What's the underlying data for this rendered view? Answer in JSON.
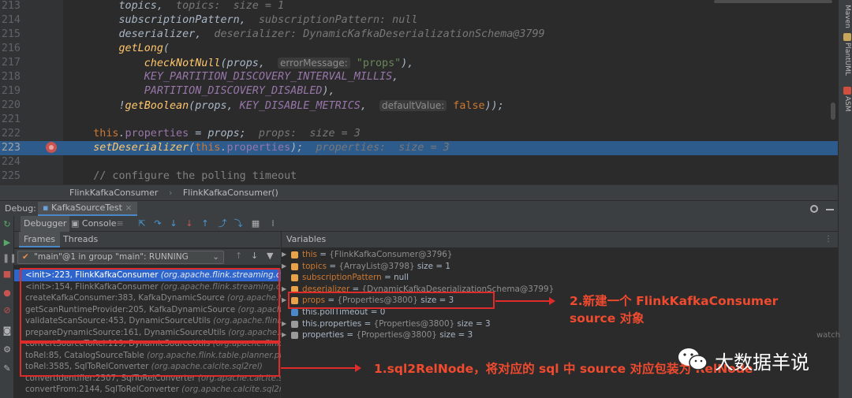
{
  "editor": {
    "lines": [
      {
        "num": "213",
        "code": [
          [
            "fnplain",
            "topics,"
          ],
          [
            "hint",
            "  topics:  size = 1"
          ]
        ],
        "indent": 8
      },
      {
        "num": "214",
        "code": [
          [
            "fnplain",
            "subscriptionPattern,"
          ],
          [
            "hint",
            "  subscriptionPattern: null"
          ]
        ],
        "indent": 8
      },
      {
        "num": "215",
        "code": [
          [
            "fnplain",
            "deserializer,"
          ],
          [
            "hint",
            "  deserializer: DynamicKafkaDeserializationSchema@3799"
          ]
        ],
        "indent": 8
      },
      {
        "num": "216",
        "code": [
          [
            "fn",
            "getLong"
          ],
          [
            "fnplain",
            "("
          ]
        ],
        "indent": 8
      },
      {
        "num": "217",
        "code": [
          [
            "fn",
            "checkNotNull"
          ],
          [
            "fnplain",
            "(props,  "
          ],
          [
            "pill",
            "errorMessage:"
          ],
          [
            "str",
            " \"props\""
          ],
          [
            "fnplain",
            "),"
          ]
        ],
        "indent": 12
      },
      {
        "num": "218",
        "code": [
          [
            "cst",
            "KEY_PARTITION_DISCOVERY_INTERVAL_MILLIS"
          ],
          [
            "fnplain",
            ","
          ]
        ],
        "indent": 12
      },
      {
        "num": "219",
        "code": [
          [
            "cst",
            "PARTITION_DISCOVERY_DISABLED"
          ],
          [
            "fnplain",
            "),"
          ]
        ],
        "indent": 12
      },
      {
        "num": "220",
        "code": [
          [
            "fnplain",
            "!"
          ],
          [
            "fn",
            "getBoolean"
          ],
          [
            "fnplain",
            "(props, "
          ],
          [
            "cst",
            "KEY_DISABLE_METRICS"
          ],
          [
            "fnplain",
            ",  "
          ],
          [
            "pill",
            "defaultValue:"
          ],
          [
            "kw",
            " false"
          ],
          [
            "fnplain",
            "));"
          ]
        ],
        "indent": 8
      },
      {
        "num": "221",
        "code": [],
        "indent": 0
      },
      {
        "num": "222",
        "code": [
          [
            "kw",
            "this"
          ],
          [
            "fnplain",
            "."
          ],
          [
            "prop",
            "properties"
          ],
          [
            "fnplain",
            " = props;"
          ],
          [
            "hint",
            "  props:  size = 3"
          ]
        ],
        "indent": 4
      },
      {
        "num": "223",
        "code": [
          [
            "fn",
            "setDeserializer"
          ],
          [
            "fnplain",
            "("
          ],
          [
            "kw",
            "this"
          ],
          [
            "fnplain",
            "."
          ],
          [
            "prop",
            "properties"
          ],
          [
            "fnplain",
            ");"
          ],
          [
            "hint",
            "  properties:  size = 3"
          ]
        ],
        "indent": 4,
        "highlight": true
      },
      {
        "num": "224",
        "code": [],
        "indent": 0
      },
      {
        "num": "225",
        "code": [
          [
            "cmt",
            "// configure the polling timeout"
          ]
        ],
        "indent": 4
      }
    ]
  },
  "breadcrumb": {
    "class_name": "FlinkKafkaConsumer",
    "method_name": "FlinkKafkaConsumer()"
  },
  "debug": {
    "label": "Debug:",
    "session_tab": "KafkaSourceTest",
    "tabs": {
      "debugger": "Debugger",
      "console": "Console"
    },
    "frames_tab": "Frames",
    "threads_tab": "Threads",
    "variables_title": "Variables",
    "thread": "\"main\"@1 in group \"main\": RUNNING",
    "watches_label": "watch"
  },
  "frames": [
    {
      "name": "<init>:223, FlinkKafkaConsumer",
      "pkg": "(org.apache.flink.streaming.connec",
      "selected": true
    },
    {
      "name": "<init>:154, FlinkKafkaConsumer",
      "pkg": "(org.apache.flink.streaming.connect"
    },
    {
      "name": "createKafkaConsumer:383, KafkaDynamicSource",
      "pkg": "(org.apache.flink.s"
    },
    {
      "name": "getScanRuntimeProvider:205, KafkaDynamicSource",
      "pkg": "(org.apache.flink"
    },
    {
      "name": "validateScanSource:453, DynamicSourceUtils",
      "pkg": "(org.apache.flink.table"
    },
    {
      "name": "prepareDynamicSource:161, DynamicSourceUtils",
      "pkg": "(org.apache.flink.ta"
    },
    {
      "name": "convertSourceToRel:119, DynamicSourceUtils",
      "pkg": "(org.apache.flink.table"
    },
    {
      "name": "toRel:85, CatalogSourceTable",
      "pkg": "(org.apache.flink.table.planner.plan.sc"
    },
    {
      "name": "toRel:3585, SqlToRelConverter",
      "pkg": "(org.apache.calcite.sql2rel)"
    },
    {
      "name": "convertIdentifier:2507, SqlToRelConverter",
      "pkg": "(org.apache.calcite.sql2re"
    },
    {
      "name": "convertFrom:2144, SqlToRelConverter",
      "pkg": "(org.apache.calcite.sql2rel)"
    }
  ],
  "variables": [
    {
      "arrow": "▶",
      "icon": "#e8a34a",
      "name": "this",
      "local": false,
      "eq": " = ",
      "type": "{FlinkKafkaConsumer@3796}",
      "extra": ""
    },
    {
      "arrow": "▶",
      "icon": "#e8a34a",
      "name": "topics",
      "local": false,
      "eq": " = ",
      "type": "{ArrayList@3798}",
      "extra": "  size = 1"
    },
    {
      "arrow": "",
      "icon": "#e8a34a",
      "name": "subscriptionPattern",
      "local": false,
      "eq": " = ",
      "type": "",
      "extra": "null"
    },
    {
      "arrow": "▶",
      "icon": "#e8a34a",
      "name": "deserializer",
      "local": false,
      "eq": " = ",
      "type": "{DynamicKafkaDeserializationSchema@3799}",
      "extra": ""
    },
    {
      "arrow": "▶",
      "icon": "#e8a34a",
      "name": "props",
      "local": false,
      "eq": " = ",
      "type": "{Properties@3800}",
      "extra": "  size = 3"
    },
    {
      "arrow": "",
      "icon": "#4a88c7",
      "name": "this.pollTimeout",
      "local": true,
      "eq": " = ",
      "type": "",
      "extra": "0"
    },
    {
      "arrow": "▶",
      "icon": "#9a9a9a",
      "name": "this.properties",
      "local": true,
      "eq": " = ",
      "type": "{Properties@3800}",
      "extra": "  size = 3"
    },
    {
      "arrow": "▶",
      "icon": "#9a9a9a",
      "name": "properties",
      "local": true,
      "eq": " = ",
      "type": "{Properties@3800}",
      "extra": "  size = 3"
    }
  ],
  "annotations": {
    "note2_line1": "2.新建一个 FlinkKafkaConsumer",
    "note2_line2": "source 对象",
    "note1": "1.sql2RelNode，将对应的 sql 中 source 对应包装为 RelNode"
  },
  "watermark": {
    "text": "大数据羊说"
  },
  "right_strip": [
    "Maven",
    "PlantUML",
    "ASM"
  ],
  "colors": {
    "accent": "#e02b2b",
    "selection": "#2f65ca",
    "highlight": "#2d5b8c"
  }
}
